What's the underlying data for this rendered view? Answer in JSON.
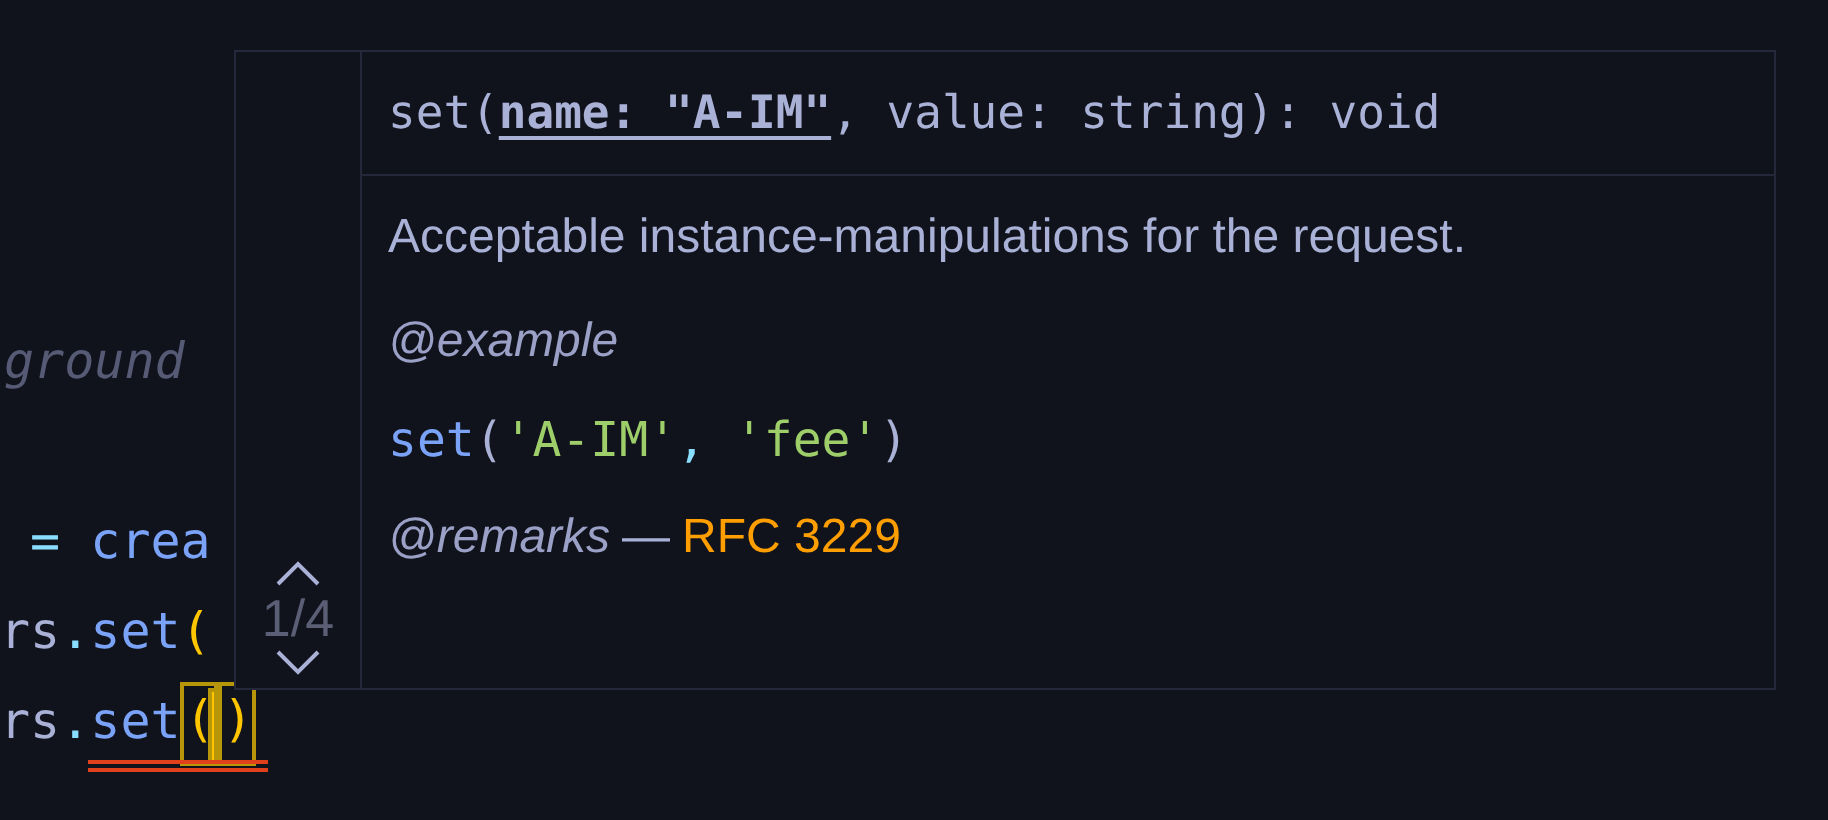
{
  "editor": {
    "lines": [
      {
        "tokens": [
          {
            "text": "ground",
            "kind": "comment"
          }
        ]
      },
      {
        "tokens": [
          {
            "text": " = ",
            "kind": "operator"
          },
          {
            "text": "crea",
            "kind": "function"
          }
        ]
      },
      {
        "tokens": [
          {
            "text": "rs",
            "kind": "plain"
          },
          {
            "text": ".",
            "kind": "operator"
          },
          {
            "text": "set",
            "kind": "function"
          },
          {
            "text": "(",
            "kind": "paren"
          }
        ]
      },
      {
        "tokens": [
          {
            "text": "rs",
            "kind": "plain"
          },
          {
            "text": ".",
            "kind": "operator"
          },
          {
            "text": "set",
            "kind": "function"
          },
          {
            "text": "()",
            "kind": "matched-parens"
          }
        ],
        "error": true
      }
    ]
  },
  "hover": {
    "counter": "1/4",
    "signature": "set(**name: \"A-IM\"**, value: string): void",
    "description": "Acceptable instance-manipulations for the request.",
    "example_tag": "@example",
    "example": [
      {
        "text": "set",
        "kind": "function"
      },
      {
        "text": "(",
        "kind": "punct"
      },
      {
        "text": "'A-IM'",
        "kind": "string"
      },
      {
        "text": ", ",
        "kind": "comma"
      },
      {
        "text": "'fee'",
        "kind": "string"
      },
      {
        "text": ")",
        "kind": "punct"
      }
    ],
    "remarks_tag": "@remarks",
    "remarks_dash": "—",
    "remarks_link": "RFC 3229"
  }
}
